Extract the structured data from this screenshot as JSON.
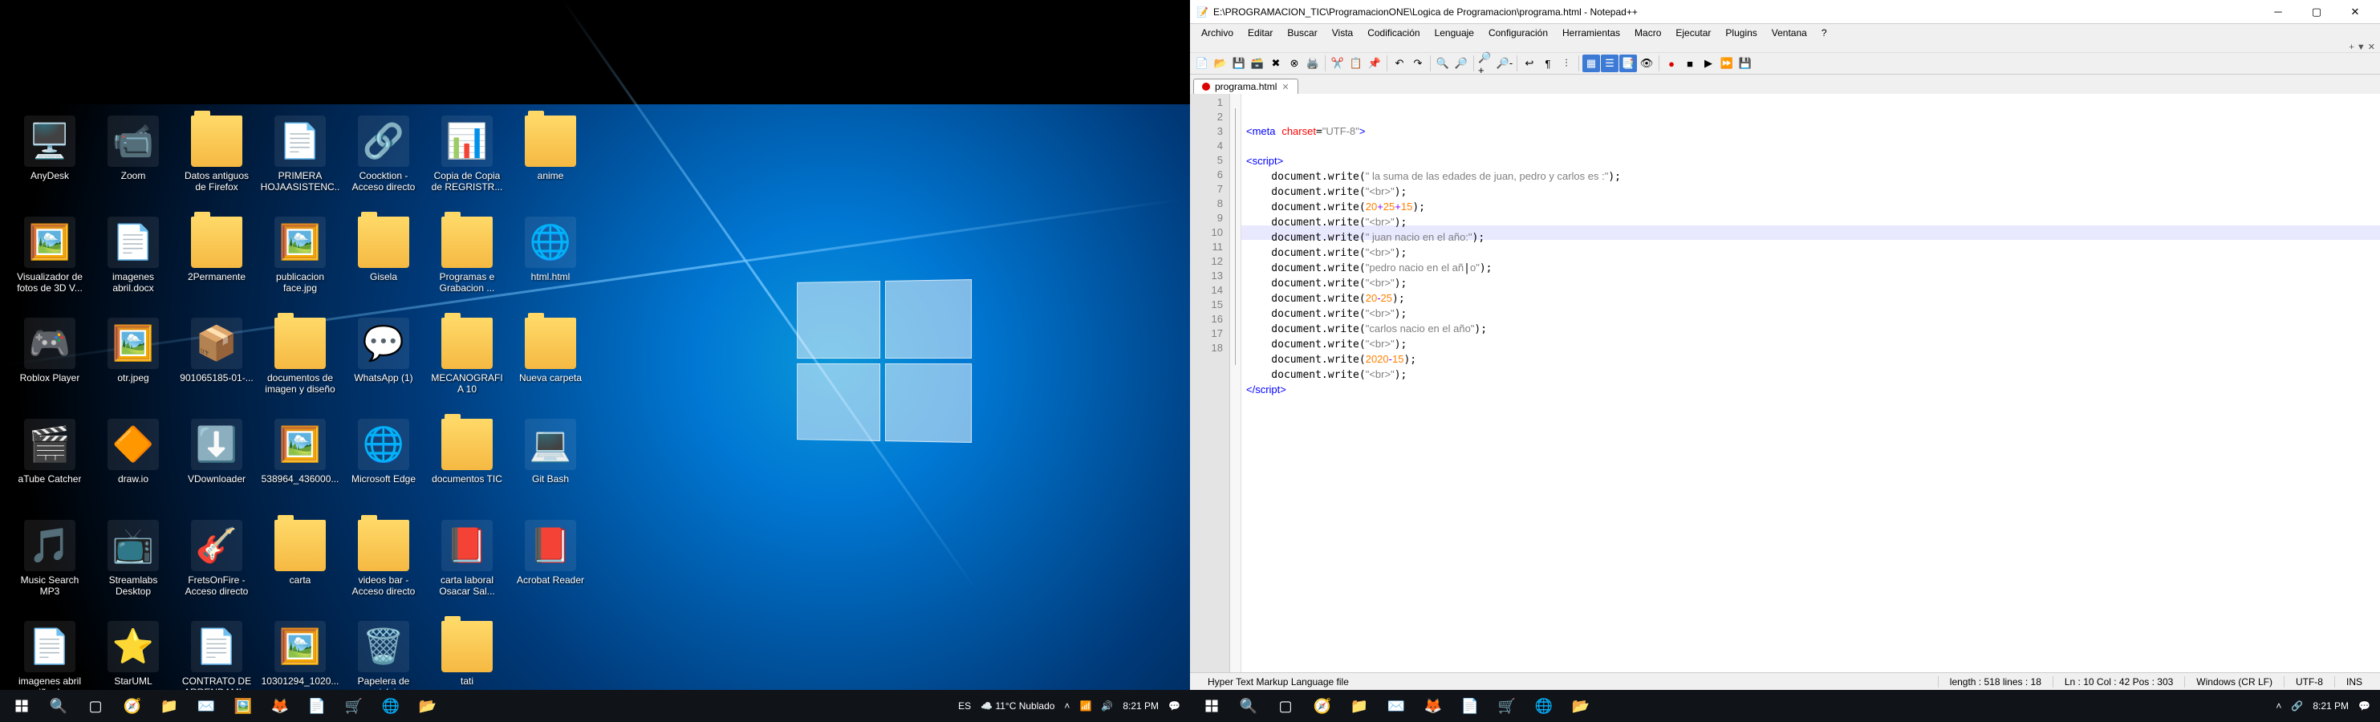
{
  "left": {
    "icons": [
      {
        "label": "AnyDesk",
        "g": "🖥️"
      },
      {
        "label": "Zoom",
        "g": "📹"
      },
      {
        "label": "Datos antiguos de Firefox",
        "g": "📁",
        "folder": true
      },
      {
        "label": "PRIMERA HOJAASISTENC...",
        "g": "📄"
      },
      {
        "label": "Coocktion - Acceso directo",
        "g": "🔗"
      },
      {
        "label": "Copia de Copia de REGRISTR...",
        "g": "📊"
      },
      {
        "label": "anime",
        "g": "📁",
        "folder": true
      },
      {
        "label": "Visualizador de fotos de 3D V...",
        "g": "🖼️"
      },
      {
        "label": "imagenes abril.docx",
        "g": "📄"
      },
      {
        "label": "2Permanente",
        "g": "📁",
        "folder": true
      },
      {
        "label": "publicacion face.jpg",
        "g": "🖼️"
      },
      {
        "label": "Gisela",
        "g": "📁",
        "folder": true
      },
      {
        "label": "Programas e Grabacion ...",
        "g": "📁",
        "folder": true
      },
      {
        "label": "html.html",
        "g": "🌐"
      },
      {
        "label": "Roblox Player",
        "g": "🎮"
      },
      {
        "label": "otr.jpeg",
        "g": "🖼️"
      },
      {
        "label": "901065185-01-...",
        "g": "📦"
      },
      {
        "label": "documentos de imagen y diseño",
        "g": "📁",
        "folder": true
      },
      {
        "label": "WhatsApp (1)",
        "g": "💬"
      },
      {
        "label": "MECANOGRAFIA 10",
        "g": "📁",
        "folder": true
      },
      {
        "label": "Nueva carpeta",
        "g": "📁",
        "folder": true
      },
      {
        "label": "aTube Catcher",
        "g": "🎬"
      },
      {
        "label": "draw.io",
        "g": "🔶"
      },
      {
        "label": "VDownloader",
        "g": "⬇️"
      },
      {
        "label": "538964_436000...",
        "g": "🖼️"
      },
      {
        "label": "Microsoft Edge",
        "g": "🌐"
      },
      {
        "label": "documentos TIC",
        "g": "📁",
        "folder": true
      },
      {
        "label": "Git Bash",
        "g": "💻"
      },
      {
        "label": "Music Search MP3",
        "g": "🎵"
      },
      {
        "label": "Streamlabs Desktop",
        "g": "📺"
      },
      {
        "label": "FretsOnFire - Acceso directo",
        "g": "🎸"
      },
      {
        "label": "carta",
        "g": "📁",
        "folder": true
      },
      {
        "label": "videos bar - Acceso directo",
        "g": "📁",
        "folder": true
      },
      {
        "label": "carta laboral Osacar Sal...",
        "g": "📕"
      },
      {
        "label": "Acrobat Reader",
        "g": "📕"
      },
      {
        "label": "imagenes abril nariño.docx",
        "g": "📄"
      },
      {
        "label": "StarUML",
        "g": "⭐"
      },
      {
        "label": "CONTRATO DE ARRENDAMI...",
        "g": "📄"
      },
      {
        "label": "10301294_1020...",
        "g": "🖼️"
      },
      {
        "label": "Papelera de reciclaje",
        "g": "🗑️"
      },
      {
        "label": "tati",
        "g": "📁",
        "folder": true
      }
    ],
    "taskbar_tray": {
      "lang": "ES",
      "weather": "11°C Nublado",
      "time": "8:21 PM"
    }
  },
  "npp": {
    "title": "E:\\PROGRAMACION_TIC\\ProgramacionONE\\Logica de Programacion\\programa.html - Notepad++",
    "menus": [
      "Archivo",
      "Editar",
      "Buscar",
      "Vista",
      "Codificación",
      "Lenguaje",
      "Configuración",
      "Herramientas",
      "Macro",
      "Ejecutar",
      "Plugins",
      "Ventana",
      "?"
    ],
    "tab": {
      "name": "programa.html"
    },
    "lines": [
      "1",
      "2",
      "3",
      "4",
      "5",
      "6",
      "7",
      "8",
      "9",
      "10",
      "11",
      "12",
      "13",
      "14",
      "15",
      "16",
      "17",
      "18"
    ],
    "status": {
      "type": "Hyper Text Markup Language file",
      "len": "length : 518    lines : 18",
      "pos": "Ln : 10    Col : 42    Pos : 303",
      "eol": "Windows (CR LF)",
      "enc": "UTF-8",
      "ins": "INS"
    }
  },
  "tb2": {
    "time": "8:21 PM"
  }
}
